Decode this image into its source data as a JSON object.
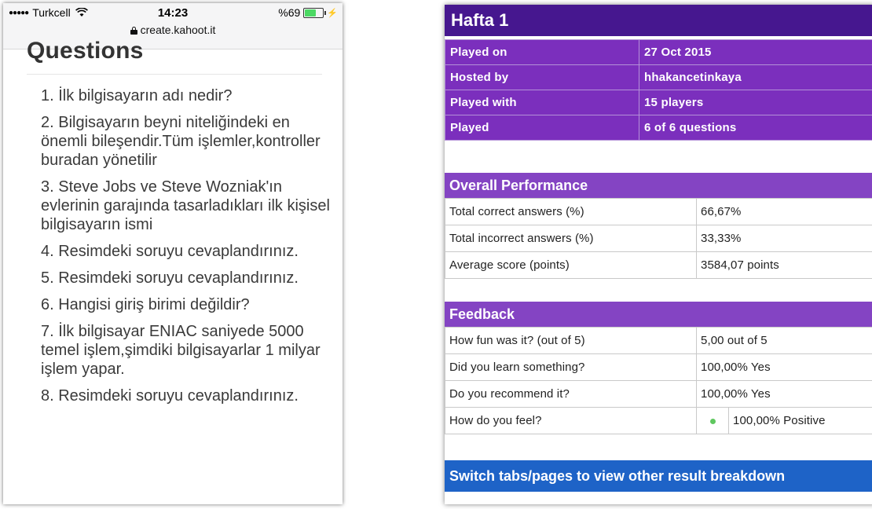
{
  "phone": {
    "status": {
      "carrier": "Turkcell",
      "time": "14:23",
      "battery_text": "%69",
      "battery_level": 0.69,
      "url": "create.kahoot.it"
    },
    "heading": "Questions",
    "questions": [
      "1. İlk bilgisayarın adı nedir?",
      "2. Bilgisayarın beyni niteliğindeki en önemli bileşendir.Tüm işlemler,kontroller buradan yönetilir",
      "3. Steve Jobs ve Steve Wozniak'ın evlerinin garajında tasarladıkları ilk kişisel bilgisayarın ismi",
      "4. Resimdeki soruyu cevaplandırınız.",
      "5. Resimdeki soruyu cevaplandırınız.",
      "6. Hangisi giriş birimi değildir?",
      "7. İlk bilgisayar ENIAC saniyede 5000 temel işlem,şimdiki bilgisayarlar 1 milyar işlem yapar.",
      "8. Resimdeki soruyu cevaplandırınız."
    ]
  },
  "report": {
    "title": "Hafta 1",
    "info": [
      {
        "label": "Played on",
        "value": "27 Oct 2015"
      },
      {
        "label": "Hosted by",
        "value": "hhakancetinkaya"
      },
      {
        "label": "Played with",
        "value": "15 players"
      },
      {
        "label": "Played",
        "value": "6 of 6 questions"
      }
    ],
    "overall": {
      "heading": "Overall Performance",
      "rows": [
        {
          "label": "Total correct answers (%)",
          "value": "66,67%"
        },
        {
          "label": "Total incorrect answers (%)",
          "value": "33,33%"
        },
        {
          "label": "Average score (points)",
          "value": "3584,07 points"
        }
      ]
    },
    "feedback": {
      "heading": "Feedback",
      "rows": [
        {
          "label": "How fun was it? (out of 5)",
          "value": "5,00 out of 5"
        },
        {
          "label": "Did you learn something?",
          "value": "100,00% Yes"
        },
        {
          "label": "Do you recommend it?",
          "value": "100,00% Yes"
        }
      ],
      "feel": {
        "label": "How do you feel?",
        "icon": "smile-icon",
        "value": "100,00% Positive"
      }
    },
    "footer": "Switch tabs/pages to view other result breakdown",
    "colors": {
      "title": "#46178f",
      "info": "#7b2fbd",
      "section": "#8444c3",
      "footer": "#1e63c7"
    }
  }
}
